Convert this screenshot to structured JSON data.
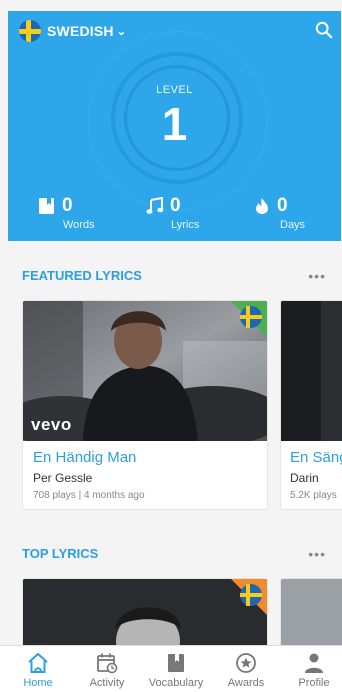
{
  "header": {
    "language": "SWEDISH",
    "level_label": "LEVEL",
    "level_value": "1",
    "stats": [
      {
        "icon": "book-icon",
        "value": "0",
        "label": "Words"
      },
      {
        "icon": "music-note-icon",
        "value": "0",
        "label": "Lyrics"
      },
      {
        "icon": "flame-icon",
        "value": "0",
        "label": "Days"
      }
    ]
  },
  "featured": {
    "title": "FEATURED LYRICS",
    "more": "•••",
    "cards": [
      {
        "title": "En Händig Man",
        "artist": "Per Gessle",
        "meta": "708 plays | 4 months ago",
        "badge": "vevo"
      },
      {
        "title": "En Säng",
        "artist": "Darin",
        "meta": "5.2K plays"
      }
    ]
  },
  "top": {
    "title": "TOP LYRICS",
    "more": "•••"
  },
  "nav": [
    {
      "icon": "home-icon",
      "label": "Home",
      "active": true
    },
    {
      "icon": "activity-calendar-icon",
      "label": "Activity"
    },
    {
      "icon": "vocabulary-book-icon",
      "label": "Vocabulary"
    },
    {
      "icon": "award-medal-icon",
      "label": "Awards"
    },
    {
      "icon": "profile-person-icon",
      "label": "Profile"
    }
  ],
  "colors": {
    "accent": "#2ea6ea",
    "flag_blue": "#1f66b3",
    "flag_yellow": "#f7cc1a"
  }
}
